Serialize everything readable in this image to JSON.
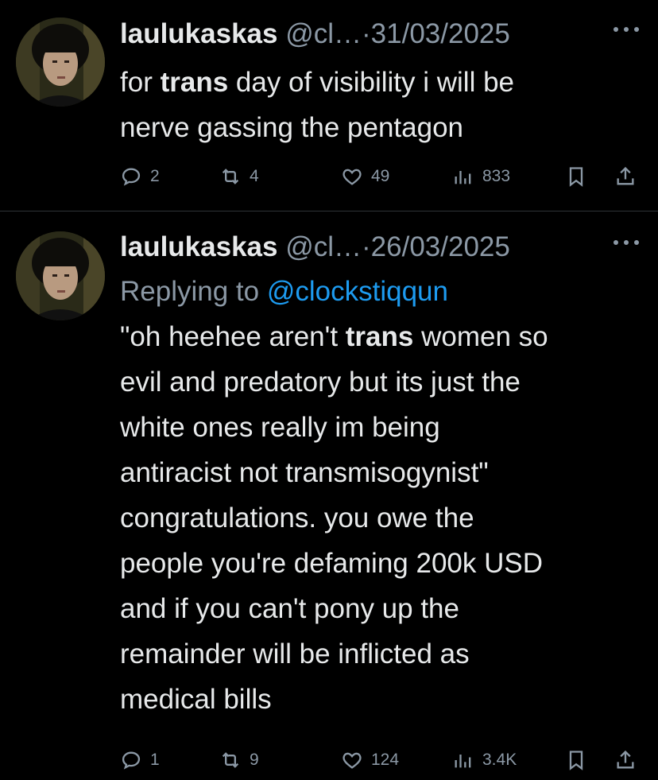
{
  "tweets": [
    {
      "name": "laulukaskas",
      "handle": "@cl…",
      "dot": "·",
      "date": "31/03/2025",
      "text_parts": [
        "for ",
        "trans",
        " day of visibility i will be\nnerve gassing the pentagon"
      ],
      "stats": {
        "replies": "2",
        "reposts": "4",
        "likes": "49",
        "views": "833"
      }
    },
    {
      "name": "laulukaskas",
      "handle": "@cl…",
      "dot": "·",
      "date": "26/03/2025",
      "replying_prefix": "Replying to ",
      "replying_mention": "@clockstiqqun",
      "text_parts": [
        "\"oh heehee aren't ",
        "trans",
        " women so\nevil and predatory but its just the\nwhite ones really im being\nantiracist not transmisogynist\"\ncongratulations. you owe the\npeople you're defaming 200k USD\nand if you can't pony up the\nremainder will be inflicted as\nmedical bills"
      ],
      "stats": {
        "replies": "1",
        "reposts": "9",
        "likes": "124",
        "views": "3.4K"
      }
    }
  ],
  "icons": {
    "reply": "reply-icon",
    "repost": "repost-icon",
    "like": "like-icon",
    "views": "views-icon",
    "bookmark": "bookmark-icon",
    "share": "share-icon",
    "more": "more-icon"
  },
  "colors": {
    "background": "#000000",
    "text": "#e7e9ea",
    "muted": "#8b98a5",
    "link": "#1d9bf0",
    "divider": "#2f3336"
  }
}
